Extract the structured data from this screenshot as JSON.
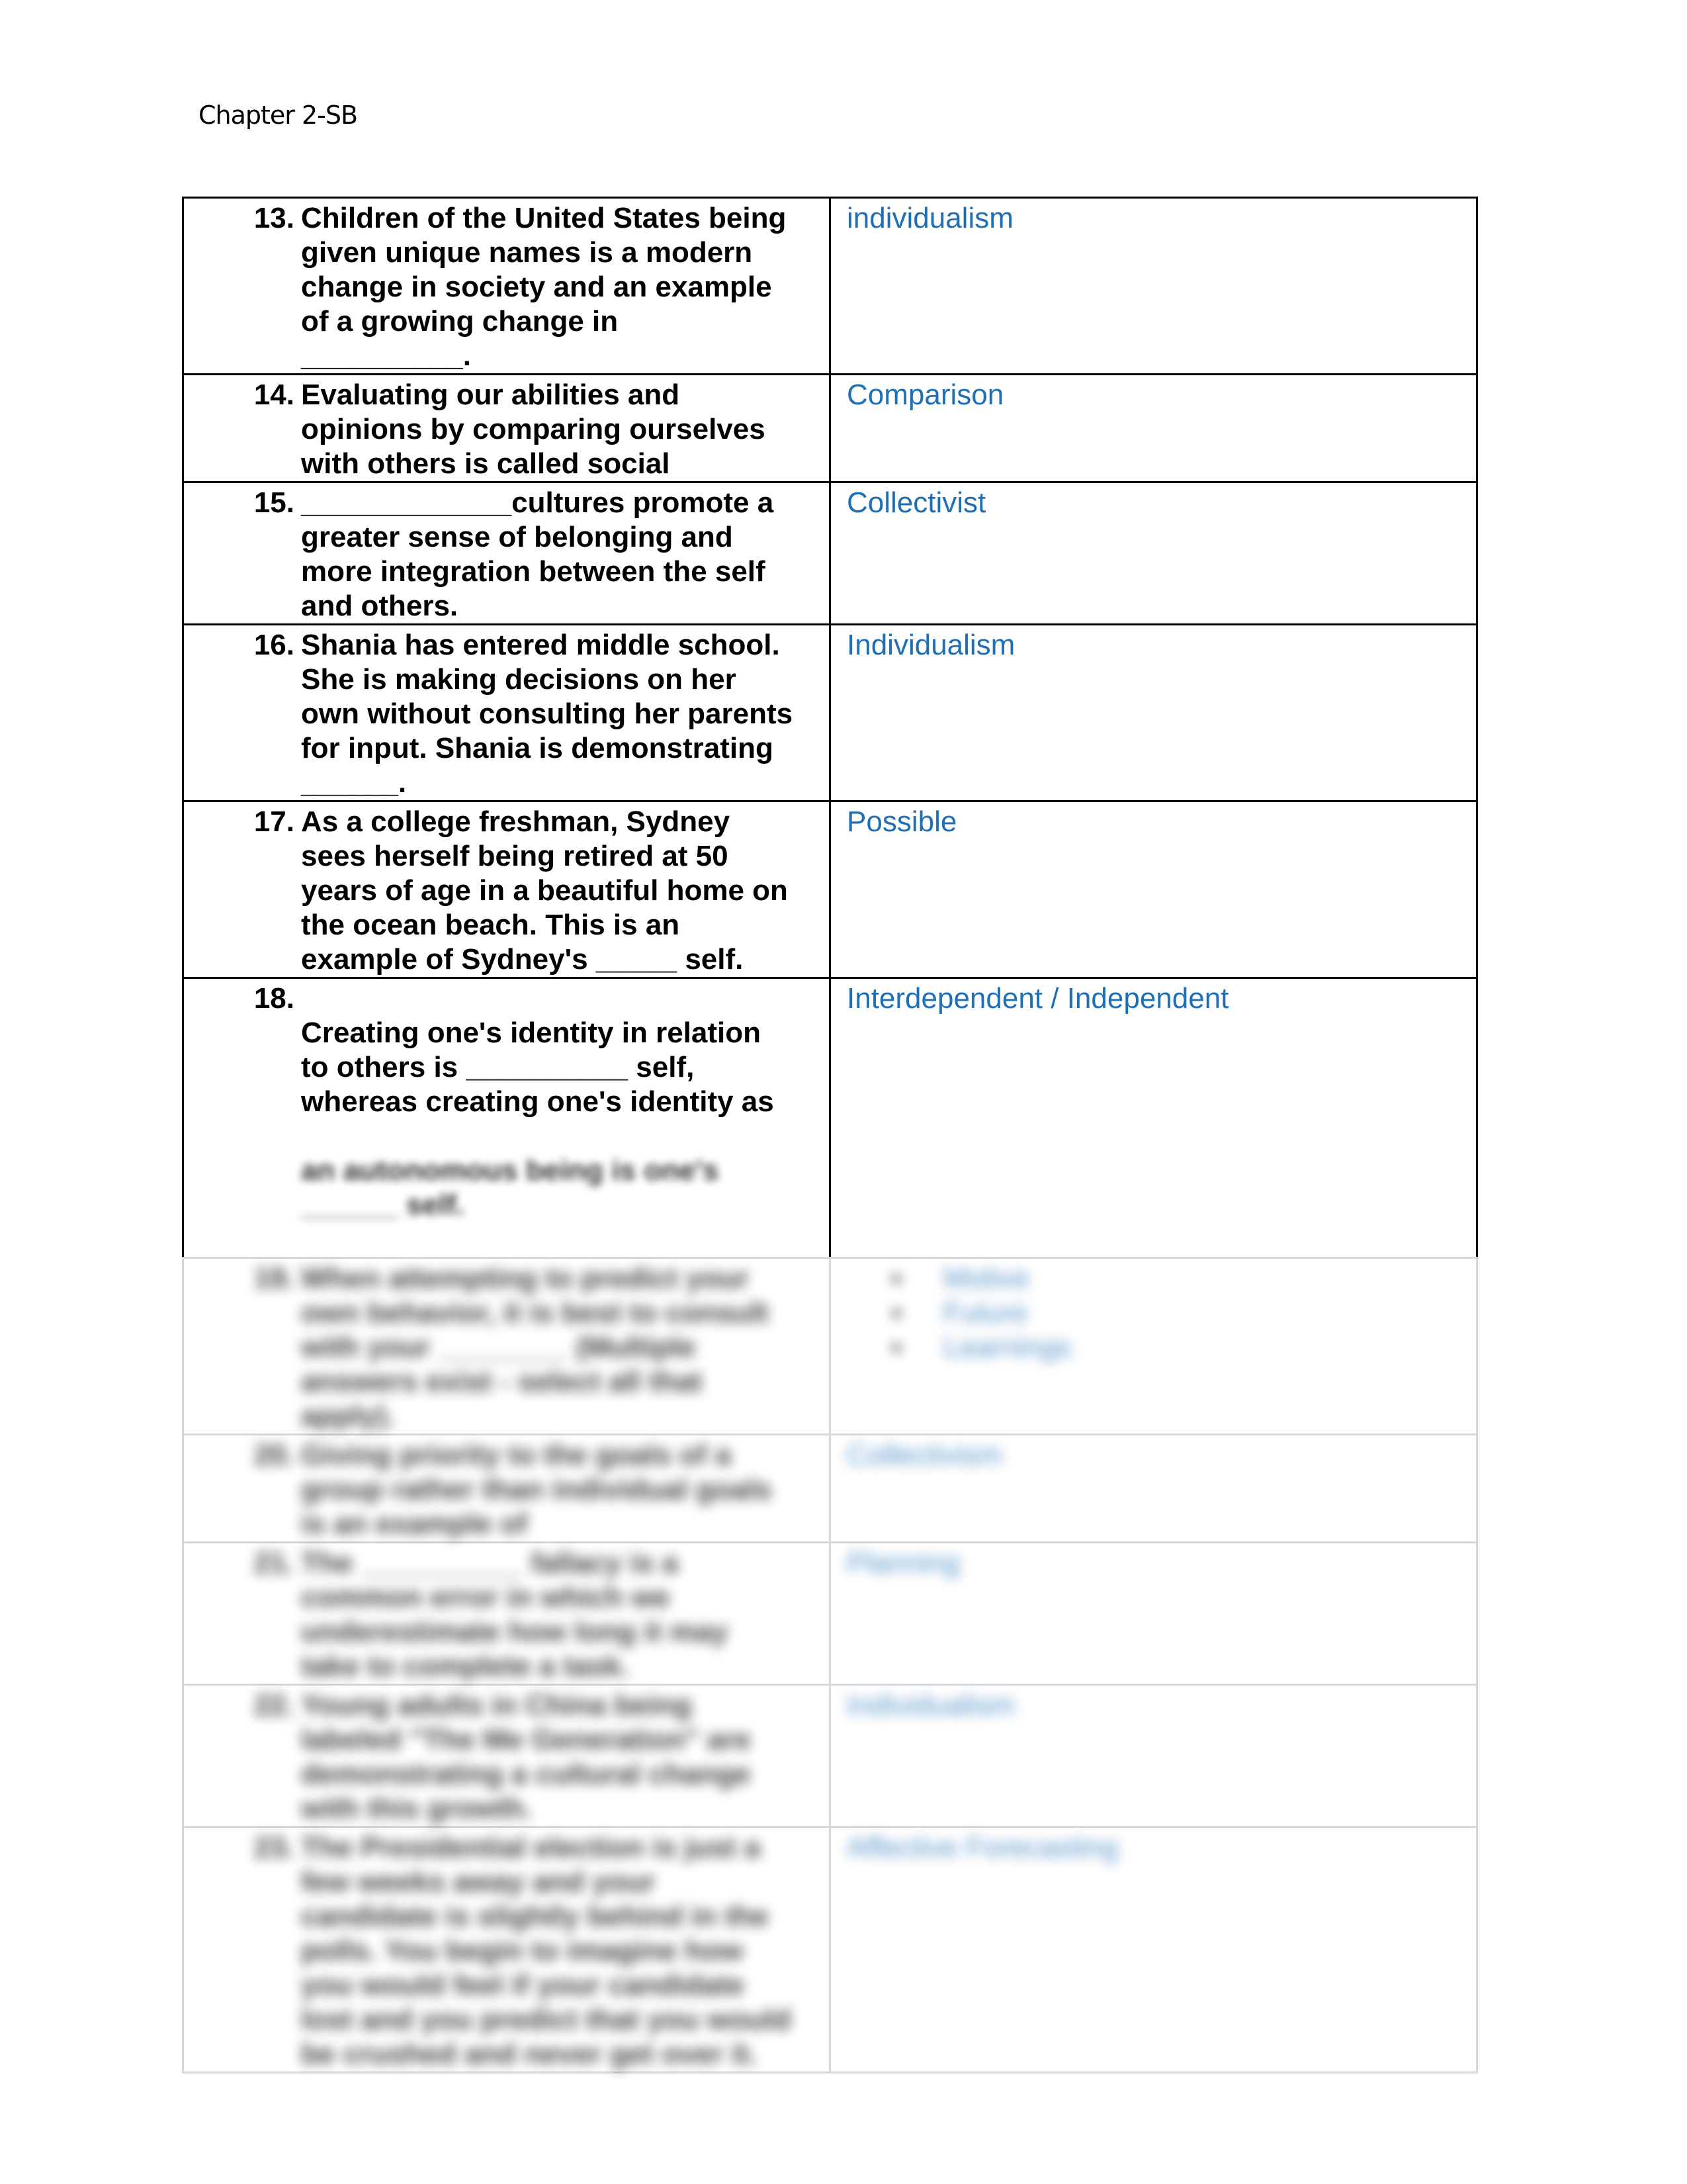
{
  "header": {
    "title": "Chapter 2-SB"
  },
  "table": {
    "rows": [
      {
        "number": "13.",
        "question": "Children of the United States being\ngiven unique names is a modern\nchange in society and an example\nof a growing change in\n__________.",
        "answer": "individualism"
      },
      {
        "number": "14.",
        "question": "Evaluating our abilities and\nopinions by comparing ourselves\nwith others is called social",
        "answer": "Comparison"
      },
      {
        "number": "15.",
        "question": "_____________cultures promote a\ngreater sense of belonging and\nmore integration between the self\nand others.",
        "answer": "Collectivist"
      },
      {
        "number": "16.",
        "question": "Shania has entered middle school.\nShe is making decisions on her\nown without consulting her parents\nfor input. Shania is demonstrating\n______.",
        "answer": "Individualism"
      },
      {
        "number": "17.",
        "question": "As a college freshman, Sydney\nsees herself being retired at 50\nyears of age in a beautiful home on\nthe ocean beach. This is an\nexample of Sydney's _____ self.",
        "answer": "Possible"
      },
      {
        "number": "18.",
        "question_visible": "Creating one's identity in relation\nto others is __________ self,\nwhereas creating one's identity as",
        "question_blurred": "an autonomous being is one's\n______ self.",
        "answer": "Interdependent / Independent"
      }
    ],
    "blurred_rows": [
      {
        "number": "19.",
        "question": "When attempting to predict your\nown behavior, it is best to consult\nwith your ________ (Multiple\nanswers exist - select all that\napply).",
        "answers": [
          "Motive",
          "Future",
          "Learnings"
        ]
      },
      {
        "number": "20.",
        "question": "Giving priority to the goals of a\ngroup rather than individual goals\nis an example of",
        "answer": "Collectivism"
      },
      {
        "number": "21.",
        "question": "The __________ fallacy is a\ncommon error in which we\nunderestimate how long it may\ntake to complete a task.",
        "answer": "Planning"
      },
      {
        "number": "22.",
        "question": "Young adults in China being\nlabeled \"The Me Generation\" are\ndemonstrating a cultural change\nwith this growth.",
        "answer": "Individualism"
      },
      {
        "number": "23.",
        "question": "The Presidential election is just a\nfew weeks away and your\ncandidate is slightly behind in the\npolls. You begin to imagine how\nyou would feel if your candidate\nlost and you predict that you would\nbe crushed and never get over it.",
        "answer": "Affective Forecasting"
      }
    ]
  },
  "colors": {
    "answer": "#1f6fb5",
    "question": "#000000"
  }
}
